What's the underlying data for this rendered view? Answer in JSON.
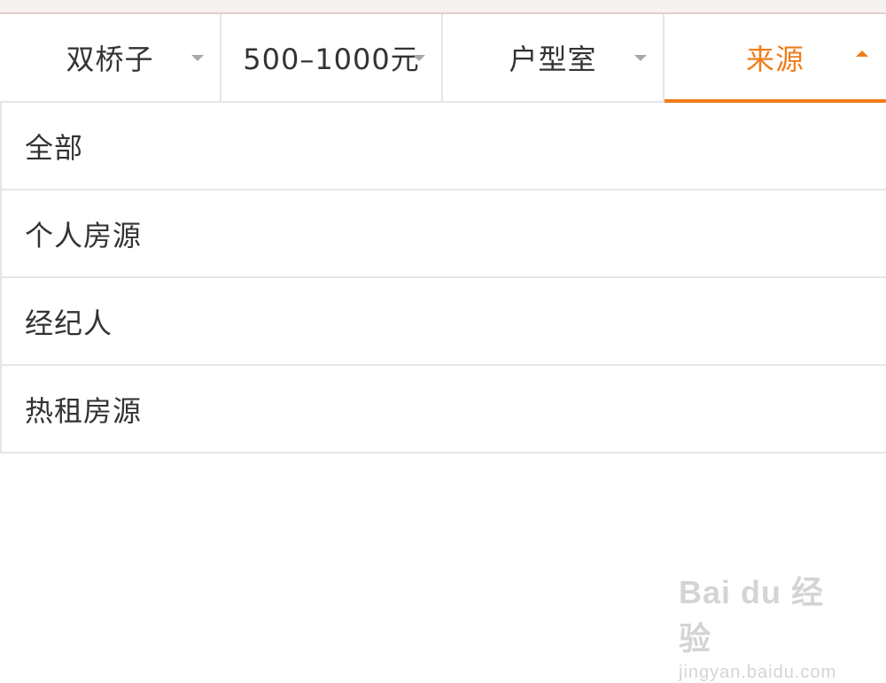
{
  "filter_bar": {
    "tabs": [
      {
        "label": "双桥子",
        "active": false
      },
      {
        "label": "500–1000元",
        "active": false
      },
      {
        "label": "户型室",
        "active": false
      },
      {
        "label": "来源",
        "active": true
      }
    ]
  },
  "dropdown": {
    "options": [
      {
        "label": "全部"
      },
      {
        "label": "个人房源"
      },
      {
        "label": "经纪人"
      },
      {
        "label": "热租房源"
      }
    ]
  },
  "watermark": {
    "logo_text": "Bai du 经验",
    "url": "jingyan.baidu.com"
  },
  "colors": {
    "accent": "#ef7d1a",
    "text": "#333333",
    "divider": "#e6e6e6"
  }
}
